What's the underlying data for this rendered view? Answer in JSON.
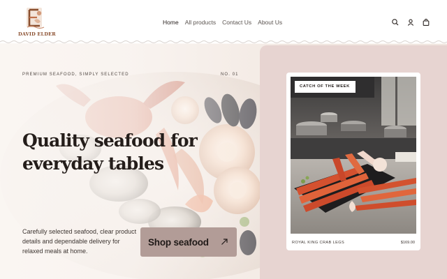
{
  "brand": {
    "name": "DAVID ELDER",
    "logo_icon": "monogram-logo"
  },
  "nav": {
    "items": [
      {
        "label": "Home",
        "active": true
      },
      {
        "label": "All products",
        "active": false
      },
      {
        "label": "Contact Us",
        "active": false
      },
      {
        "label": "About Us",
        "active": false
      }
    ]
  },
  "header_icons": [
    "search-icon",
    "account-icon",
    "cart-icon"
  ],
  "hero": {
    "eyebrow": "PREMIUM SEAFOOD, SIMPLY SELECTED",
    "issue": "NO. 01",
    "headline": "Quality seafood for everyday tables",
    "description": "Carefully selected seafood, clear product details and dependable delivery for relaxed meals at home.",
    "cta_label": "Shop seafood",
    "cta_icon": "arrow-up-right-icon"
  },
  "featured": {
    "badge": "CATCH OF THE WEEK",
    "product_name": "ROYAL KING CRAB LEGS",
    "price": "$169.00"
  },
  "colors": {
    "accent": "#b29c97",
    "panel": "#e7d4d1",
    "logo_brown": "#8a4e2e",
    "text_dark": "#241d1a"
  }
}
